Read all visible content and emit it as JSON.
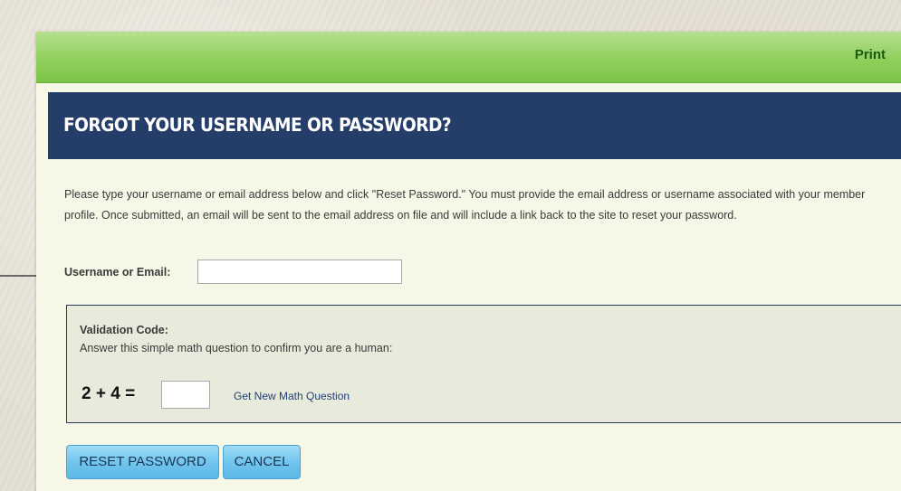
{
  "header": {
    "print_label": "Print"
  },
  "page": {
    "title": "FORGOT YOUR USERNAME OR PASSWORD?",
    "instructions": "Please type your username or email address below and click \"Reset Password.\" You must provide the email address or username associated with your member profile. Once submitted, an email will be sent to the email address on file and will include a link back to the site to reset your password."
  },
  "form": {
    "username_label": "Username or Email:",
    "username_value": "",
    "validation": {
      "title": "Validation Code:",
      "description": "Answer this simple math question to confirm you are a human:",
      "question": "2 + 4 =",
      "answer_value": "",
      "new_question_label": "Get New Math Question"
    },
    "reset_button_label": "RESET PASSWORD",
    "cancel_button_label": "CANCEL"
  },
  "annotation": {
    "arrow_icon": "right-arrow-icon"
  }
}
